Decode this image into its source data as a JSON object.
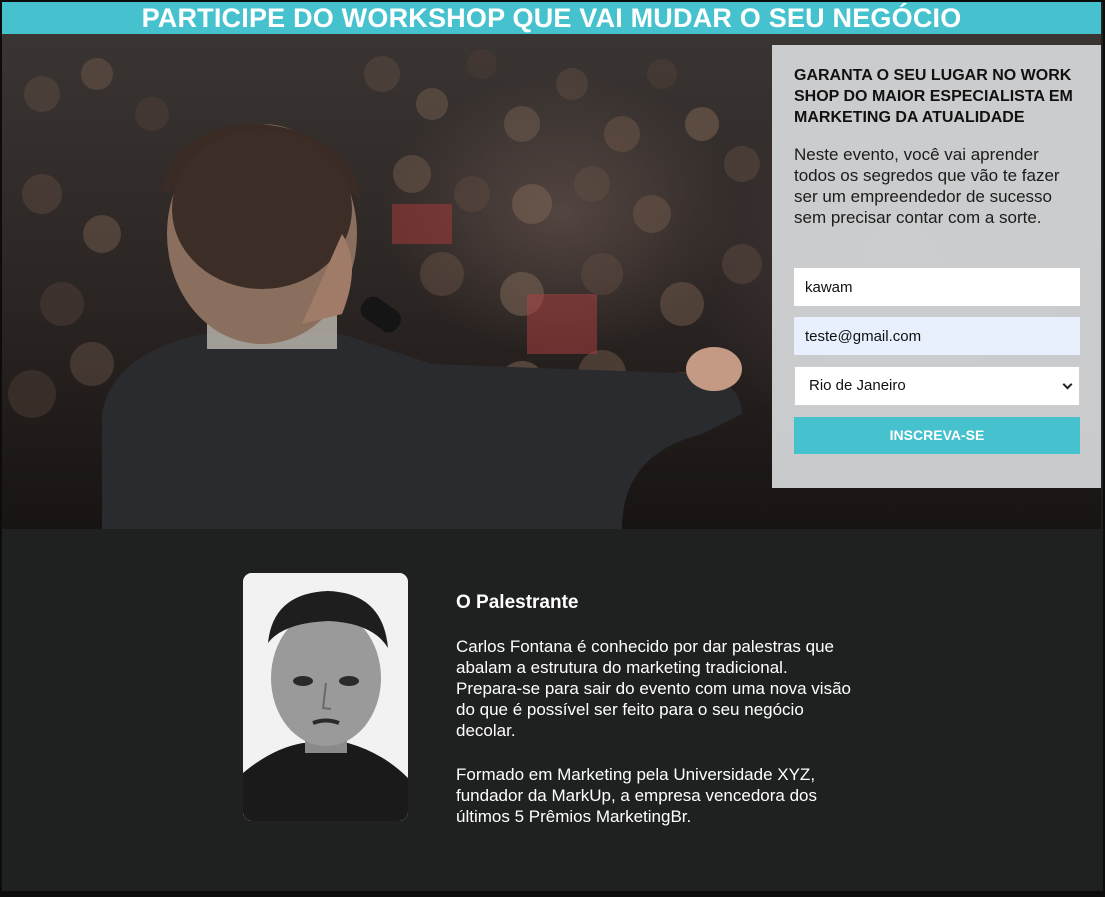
{
  "banner": {
    "title": "PARTICIPE DO WORKSHOP QUE VAI MUDAR O SEU NEGÓCIO"
  },
  "form": {
    "title": "GARANTA O SEU LUGAR NO WORK SHOP DO MAIOR ESPECIALISTA EM MARKETING DA ATUALIDADE",
    "description": "Neste evento, você vai aprender todos os segredos que vão te fazer ser um empreendedor de sucesso sem precisar contar com a sorte.",
    "name_value": "kawam",
    "email_value": "teste@gmail.com",
    "city_selected": "Rio de Janeiro",
    "submit_label": "INSCREVA-SE"
  },
  "speaker": {
    "heading": "O Palestrante",
    "bio_1": "Carlos Fontana é conhecido por dar palestras que abalam a estrutura do marketing tradicional. Prepara-se para sair do evento com uma nova visão do que é possível ser feito para o seu negócio decolar.",
    "bio_2": "Formado em Marketing pela Universidade XYZ, fundador da MarkUp, a empresa vencedora dos últimos 5 Prêmios MarketingBr."
  },
  "colors": {
    "accent": "#46c2cf",
    "dark_section": "#1f2020",
    "form_card": "#d6d8da"
  },
  "icons": {
    "select_chevron": "chevron-down-icon"
  }
}
